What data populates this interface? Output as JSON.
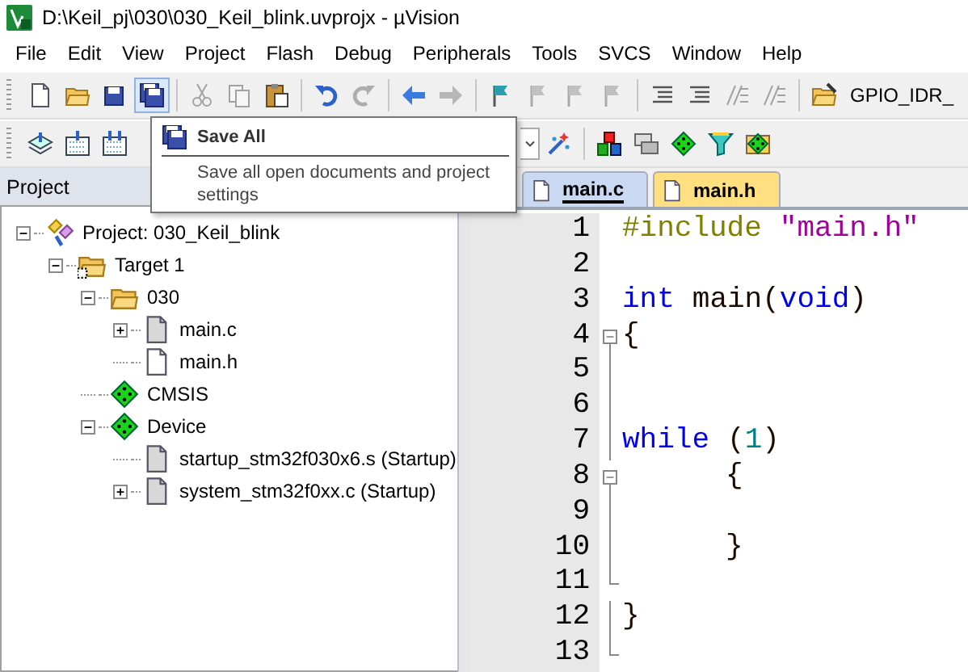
{
  "window": {
    "title": "D:\\Keil_pj\\030\\030_Keil_blink.uvprojx - µVision"
  },
  "menu": [
    "File",
    "Edit",
    "View",
    "Project",
    "Flash",
    "Debug",
    "Peripherals",
    "Tools",
    "SVCS",
    "Window",
    "Help"
  ],
  "toolbar": [
    {
      "kind": "new",
      "disabled": false,
      "highlighted": false
    },
    {
      "kind": "open",
      "disabled": false,
      "highlighted": false
    },
    {
      "kind": "save",
      "disabled": false,
      "highlighted": false
    },
    {
      "kind": "save-all",
      "disabled": false,
      "highlighted": true
    },
    {
      "kind": "separator"
    },
    {
      "kind": "cut",
      "disabled": true,
      "highlighted": false
    },
    {
      "kind": "copy",
      "disabled": true,
      "highlighted": false
    },
    {
      "kind": "paste",
      "disabled": false,
      "highlighted": false
    },
    {
      "kind": "separator"
    },
    {
      "kind": "undo",
      "disabled": false,
      "highlighted": false
    },
    {
      "kind": "redo",
      "disabled": true,
      "highlighted": false
    },
    {
      "kind": "separator"
    },
    {
      "kind": "back",
      "disabled": false,
      "highlighted": false
    },
    {
      "kind": "forward",
      "disabled": true,
      "highlighted": false
    },
    {
      "kind": "separator"
    },
    {
      "kind": "bookmark",
      "disabled": false,
      "highlighted": false
    },
    {
      "kind": "bookmark-prev",
      "disabled": true,
      "highlighted": false
    },
    {
      "kind": "bookmark-next",
      "disabled": true,
      "highlighted": false
    },
    {
      "kind": "bookmark-clear",
      "disabled": true,
      "highlighted": false
    },
    {
      "kind": "separator"
    },
    {
      "kind": "indent",
      "disabled": false,
      "highlighted": false
    },
    {
      "kind": "unindent",
      "disabled": false,
      "highlighted": false
    },
    {
      "kind": "comment",
      "disabled": true,
      "highlighted": false
    },
    {
      "kind": "uncomment",
      "disabled": true,
      "highlighted": false
    },
    {
      "kind": "separator"
    },
    {
      "kind": "find-in-files",
      "disabled": false,
      "highlighted": false
    },
    {
      "kind": "find-field",
      "value": "GPIO_IDR_"
    }
  ],
  "build_toolbar": [
    {
      "kind": "translate"
    },
    {
      "kind": "build"
    },
    {
      "kind": "rebuild"
    },
    {
      "kind": "gap"
    },
    {
      "kind": "dropdown"
    },
    {
      "kind": "wizard"
    },
    {
      "kind": "separator"
    },
    {
      "kind": "manage"
    },
    {
      "kind": "windows"
    },
    {
      "kind": "packs"
    },
    {
      "kind": "filter"
    },
    {
      "kind": "installer"
    }
  ],
  "tooltip": {
    "title": "Save All",
    "text": "Save all open documents and project settings"
  },
  "project_panel": {
    "title": "Project",
    "tree": [
      {
        "label": "Project: 030_Keil_blink",
        "kind": "project",
        "expanded": true,
        "children": [
          {
            "label": "Target 1",
            "kind": "target",
            "expanded": true,
            "children": [
              {
                "label": "030",
                "kind": "folder",
                "expanded": true,
                "children": [
                  {
                    "label": "main.c",
                    "kind": "source",
                    "expanded": false
                  },
                  {
                    "label": "main.h",
                    "kind": "header"
                  }
                ]
              },
              {
                "label": "CMSIS",
                "kind": "component"
              },
              {
                "label": "Device",
                "kind": "component",
                "expanded": true,
                "children": [
                  {
                    "label": "startup_stm32f030x6.s (Startup)",
                    "kind": "source"
                  },
                  {
                    "label": "system_stm32f0xx.c (Startup)",
                    "kind": "source",
                    "expanded": false
                  }
                ]
              }
            ]
          }
        ]
      }
    ]
  },
  "tabs": [
    {
      "label": "main.c",
      "selected": true,
      "color": "#c9d9f2"
    },
    {
      "label": "main.h",
      "selected": false,
      "color": "#ffdf80"
    }
  ],
  "editor": {
    "lines": [
      {
        "number": "1",
        "kind": "plain",
        "tokens": [
          {
            "kind": "preprocessor",
            "text": "#include"
          },
          {
            "kind": "string",
            "text": "\"main.h\""
          }
        ]
      },
      {
        "number": "2",
        "kind": "plain"
      },
      {
        "number": "3",
        "kind": "plain",
        "tokens": [
          {
            "kind": "keyword",
            "text": "int"
          },
          {
            "kind": "plain",
            "text": "main("
          },
          {
            "kind": "keyword",
            "text": "void"
          },
          {
            "kind": "plain",
            "text": ")"
          }
        ]
      },
      {
        "number": "4",
        "kind": "fold-start",
        "tokens": [
          {
            "kind": "plain",
            "text": "{"
          }
        ]
      },
      {
        "number": "5",
        "kind": "fold-inside"
      },
      {
        "number": "6",
        "kind": "fold-inside"
      },
      {
        "number": "7",
        "kind": "fold-inside",
        "tokens": [
          {
            "kind": "keyword",
            "text": "while"
          },
          {
            "kind": "plain",
            "text": "("
          },
          {
            "kind": "number",
            "text": "1"
          },
          {
            "kind": "plain",
            "text": ")"
          }
        ]
      },
      {
        "number": "8",
        "kind": "fold-start",
        "indent": true,
        "tokens": [
          {
            "kind": "plain",
            "text": "{"
          }
        ]
      },
      {
        "number": "9",
        "kind": "fold-inside"
      },
      {
        "number": "10",
        "kind": "fold-inside",
        "indent": true,
        "tokens": [
          {
            "kind": "plain",
            "text": "}"
          }
        ]
      },
      {
        "number": "11",
        "kind": "fold-end"
      },
      {
        "number": "12",
        "kind": "fold-inside",
        "tokens": [
          {
            "kind": "plain",
            "text": "}"
          }
        ]
      },
      {
        "number": "13",
        "kind": "fold-end"
      }
    ]
  }
}
